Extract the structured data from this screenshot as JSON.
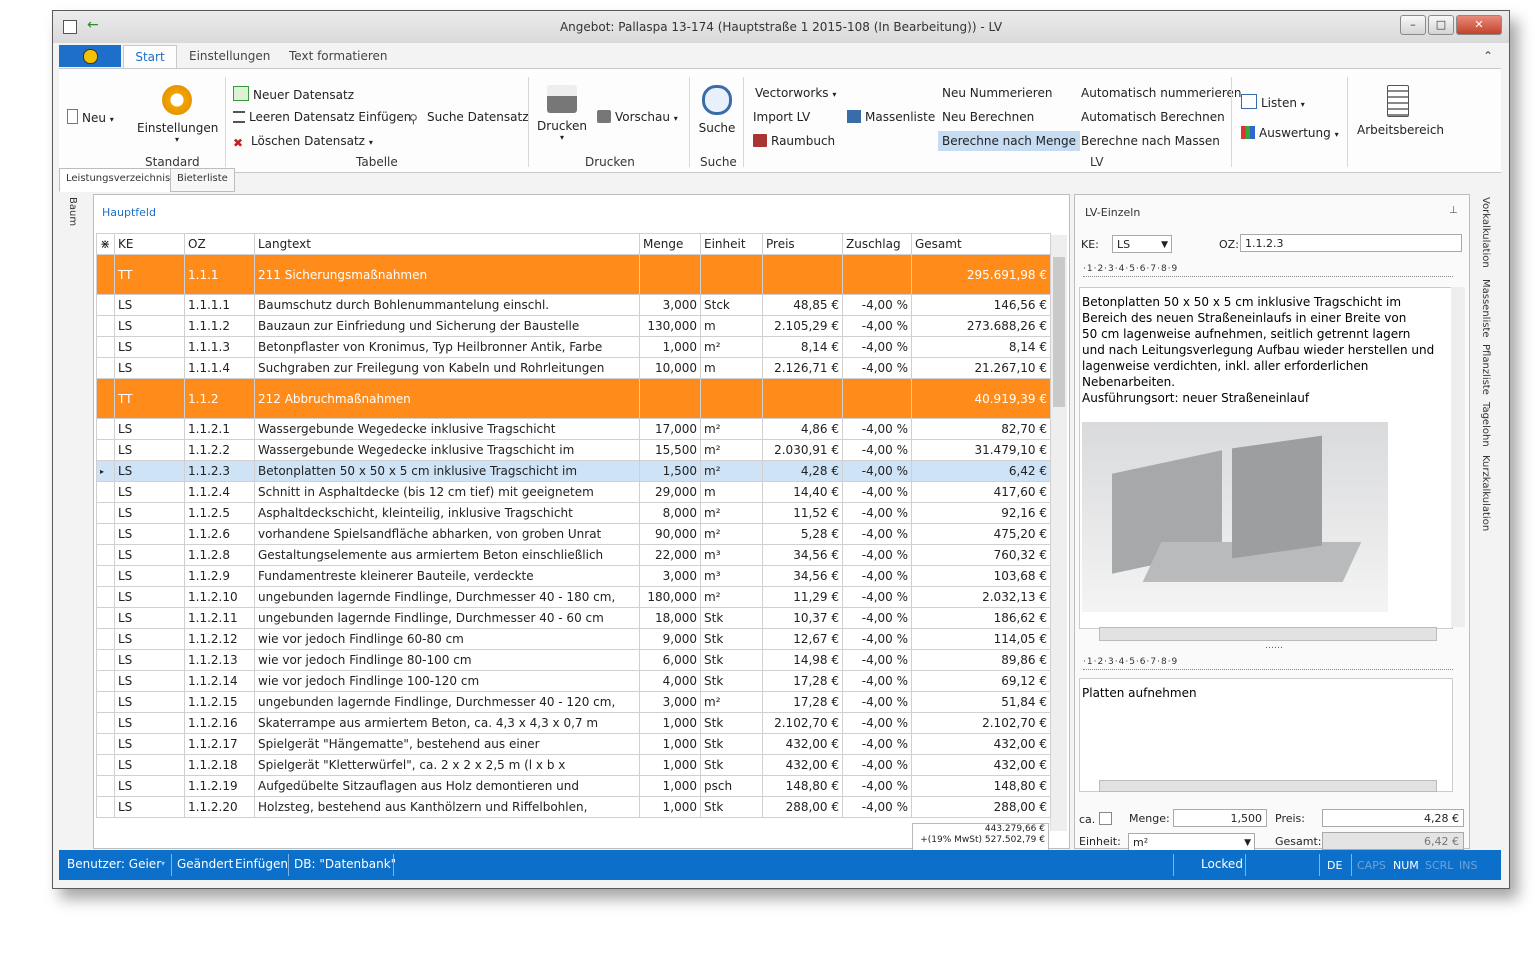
{
  "window": {
    "title": "Angebot: Pallaspa 13-174 (Hauptstraße 1 2015-108 (In Bearbeitung)) - LV"
  },
  "ribbon_tabs": [
    "Start",
    "Einstellungen",
    "Text formatieren"
  ],
  "ribbon": {
    "neu": "Neu",
    "einstellungen": "Einstellungen",
    "standard": "Standard",
    "neuer_datensatz": "Neuer Datensatz",
    "leeren_einfuegen": "Leeren Datensatz Einfügen",
    "loeschen": "Löschen Datensatz",
    "suche_datensatz": "Suche Datensatz",
    "tabelle": "Tabelle",
    "drucken": "Drucken",
    "vorschau": "Vorschau",
    "drucken_group": "Drucken",
    "suche": "Suche",
    "suche_group": "Suche",
    "vectorworks": "Vectorworks",
    "import_lv": "Import LV",
    "raumbuch": "Raumbuch",
    "massenliste": "Massenliste",
    "neu_nummerieren": "Neu Nummerieren",
    "neu_berechnen": "Neu Berechnen",
    "berechne_menge": "Berechne nach Menge",
    "auto_nummerieren": "Automatisch nummerieren",
    "auto_berechnen": "Automatisch Berechnen",
    "berechne_massen": "Berechne nach Massen",
    "lv_group": "LV",
    "listen": "Listen",
    "auswertung": "Auswertung",
    "arbeitsbereich": "Arbeitsbereich"
  },
  "subtabs": [
    "Leistungsverzeichnis",
    "Bieterliste"
  ],
  "left_vtab": "Baum",
  "grid": {
    "panel_title": "Hauptfeld",
    "headers": [
      "KE",
      "OZ",
      "Langtext",
      "Menge",
      "Einheit",
      "Preis",
      "Zuschlag",
      "Gesamt"
    ],
    "rows": [
      {
        "ke": "TT",
        "oz": "1.1.1",
        "text": "211 Sicherungsmaßnahmen",
        "menge": "",
        "einheit": "",
        "preis": "",
        "zuschlag": "",
        "gesamt": "295.691,98 €",
        "group": true
      },
      {
        "ke": "LS",
        "oz": "1.1.1.1",
        "text": "Baumschutz durch Bohlenummantelung einschl.",
        "menge": "3,000",
        "einheit": "Stck",
        "preis": "48,85 €",
        "zuschlag": "-4,00 %",
        "gesamt": "146,56 €"
      },
      {
        "ke": "LS",
        "oz": "1.1.1.2",
        "text": "Bauzaun zur Einfriedung und Sicherung der Baustelle",
        "menge": "130,000",
        "einheit": "m",
        "preis": "2.105,29 €",
        "zuschlag": "-4,00 %",
        "gesamt": "273.688,26 €"
      },
      {
        "ke": "LS",
        "oz": "1.1.1.3",
        "text": "Betonpflaster von Kronimus, Typ Heilbronner Antik, Farbe",
        "menge": "1,000",
        "einheit": "m²",
        "preis": "8,14 €",
        "zuschlag": "-4,00 %",
        "gesamt": "8,14 €"
      },
      {
        "ke": "LS",
        "oz": "1.1.1.4",
        "text": "Suchgraben zur Freilegung von Kabeln und Rohrleitungen",
        "menge": "10,000",
        "einheit": "m",
        "preis": "2.126,71 €",
        "zuschlag": "-4,00 %",
        "gesamt": "21.267,10 €"
      },
      {
        "ke": "TT",
        "oz": "1.1.2",
        "text": "212 Abbruchmaßnahmen",
        "menge": "",
        "einheit": "",
        "preis": "",
        "zuschlag": "",
        "gesamt": "40.919,39 €",
        "group": true
      },
      {
        "ke": "LS",
        "oz": "1.1.2.1",
        "text": "Wassergebunde Wegedecke inklusive Tragschicht",
        "menge": "17,000",
        "einheit": "m²",
        "preis": "4,86 €",
        "zuschlag": "-4,00 %",
        "gesamt": "82,70 €"
      },
      {
        "ke": "LS",
        "oz": "1.1.2.2",
        "text": "Wassergebunde Wegedecke inklusive Tragschicht im",
        "menge": "15,500",
        "einheit": "m²",
        "preis": "2.030,91 €",
        "zuschlag": "-4,00 %",
        "gesamt": "31.479,10 €"
      },
      {
        "ke": "LS",
        "oz": "1.1.2.3",
        "text": "Betonplatten 50 x 50 x 5 cm inklusive Tragschicht im",
        "menge": "1,500",
        "einheit": "m²",
        "preis": "4,28 €",
        "zuschlag": "-4,00 %",
        "gesamt": "6,42 €",
        "selected": true
      },
      {
        "ke": "LS",
        "oz": "1.1.2.4",
        "text": "Schnitt in Asphaltdecke (bis 12 cm tief) mit geeignetem",
        "menge": "29,000",
        "einheit": "m",
        "preis": "14,40 €",
        "zuschlag": "-4,00 %",
        "gesamt": "417,60 €"
      },
      {
        "ke": "LS",
        "oz": "1.1.2.5",
        "text": "Asphaltdeckschicht, kleinteilig, inklusive Tragschicht",
        "menge": "8,000",
        "einheit": "m²",
        "preis": "11,52 €",
        "zuschlag": "-4,00 %",
        "gesamt": "92,16 €"
      },
      {
        "ke": "LS",
        "oz": "1.1.2.6",
        "text": "vorhandene Spielsandfläche abharken, von groben Unrat",
        "menge": "90,000",
        "einheit": "m²",
        "preis": "5,28 €",
        "zuschlag": "-4,00 %",
        "gesamt": "475,20 €"
      },
      {
        "ke": "LS",
        "oz": "1.1.2.8",
        "text": "Gestaltungselemente aus armiertem Beton einschließlich",
        "menge": "22,000",
        "einheit": "m³",
        "preis": "34,56 €",
        "zuschlag": "-4,00 %",
        "gesamt": "760,32 €"
      },
      {
        "ke": "LS",
        "oz": "1.1.2.9",
        "text": "Fundamentreste kleinerer Bauteile, verdeckte",
        "menge": "3,000",
        "einheit": "m³",
        "preis": "34,56 €",
        "zuschlag": "-4,00 %",
        "gesamt": "103,68 €"
      },
      {
        "ke": "LS",
        "oz": "1.1.2.10",
        "text": "ungebunden lagernde Findlinge, Durchmesser 40 - 180 cm,",
        "menge": "180,000",
        "einheit": "m²",
        "preis": "11,29 €",
        "zuschlag": "-4,00 %",
        "gesamt": "2.032,13 €"
      },
      {
        "ke": "LS",
        "oz": "1.1.2.11",
        "text": "ungebunden lagernde Findlinge, Durchmesser 40 - 60 cm",
        "menge": "18,000",
        "einheit": "Stk",
        "preis": "10,37 €",
        "zuschlag": "-4,00 %",
        "gesamt": "186,62 €"
      },
      {
        "ke": "LS",
        "oz": "1.1.2.12",
        "text": "wie vor jedoch Findlinge 60-80 cm",
        "menge": "9,000",
        "einheit": "Stk",
        "preis": "12,67 €",
        "zuschlag": "-4,00 %",
        "gesamt": "114,05 €"
      },
      {
        "ke": "LS",
        "oz": "1.1.2.13",
        "text": "wie vor jedoch Findlinge 80-100 cm",
        "menge": "6,000",
        "einheit": "Stk",
        "preis": "14,98 €",
        "zuschlag": "-4,00 %",
        "gesamt": "89,86 €"
      },
      {
        "ke": "LS",
        "oz": "1.1.2.14",
        "text": "wie vor jedoch Findlinge 100-120 cm",
        "menge": "4,000",
        "einheit": "Stk",
        "preis": "17,28 €",
        "zuschlag": "-4,00 %",
        "gesamt": "69,12 €"
      },
      {
        "ke": "LS",
        "oz": "1.1.2.15",
        "text": "ungebunden lagernde Findlinge, Durchmesser 40 - 120 cm,",
        "menge": "3,000",
        "einheit": "m²",
        "preis": "17,28 €",
        "zuschlag": "-4,00 %",
        "gesamt": "51,84 €"
      },
      {
        "ke": "LS",
        "oz": "1.1.2.16",
        "text": "Skaterrampe aus armiertem Beton, ca. 4,3 x 4,3 x  0,7 m",
        "menge": "1,000",
        "einheit": "Stk",
        "preis": "2.102,70 €",
        "zuschlag": "-4,00 %",
        "gesamt": "2.102,70 €"
      },
      {
        "ke": "LS",
        "oz": "1.1.2.17",
        "text": "Spielgerät \"Hängematte\", bestehend aus einer",
        "menge": "1,000",
        "einheit": "Stk",
        "preis": "432,00 €",
        "zuschlag": "-4,00 %",
        "gesamt": "432,00 €"
      },
      {
        "ke": "LS",
        "oz": "1.1.2.18",
        "text": "Spielgerät \"Kletterwürfel\", ca. 2 x 2 x 2,5 m (l x b x",
        "menge": "1,000",
        "einheit": "Stk",
        "preis": "432,00 €",
        "zuschlag": "-4,00 %",
        "gesamt": "432,00 €"
      },
      {
        "ke": "LS",
        "oz": "1.1.2.19",
        "text": "Aufgedübelte Sitzauflagen aus Holz demontieren und",
        "menge": "1,000",
        "einheit": "psch",
        "preis": "148,80 €",
        "zuschlag": "-4,00 %",
        "gesamt": "148,80 €"
      },
      {
        "ke": "LS",
        "oz": "1.1.2.20",
        "text": "Holzsteg, bestehend aus Kanthölzern und Riffelbohlen,",
        "menge": "1,000",
        "einheit": "Stk",
        "preis": "288,00 €",
        "zuschlag": "-4,00 %",
        "gesamt": "288,00 €"
      }
    ],
    "total_net": "443.279,66 €",
    "total_gross": "+(19% MwSt) 527.502,79 €"
  },
  "detail": {
    "title": "LV-Einzeln",
    "ke_label": "KE:",
    "ke_value": "LS",
    "oz_label": "OZ:",
    "oz_value": "1.1.2.3",
    "ruler": "·1·2·3·4·5·6·7·8·9",
    "langtext": [
      "Betonplatten 50 x 50 x 5 cm inklusive Tragschicht im",
      "Bereich des neuen Straßeneinlaufs in einer Breite von",
      "50 cm lagenweise aufnehmen, seitlich getrennt lagern",
      "und nach Leitungsverlegung Aufbau wieder herstellen und",
      "lagenweise verdichten, inkl. aller erforderlichen",
      "Nebenarbeiten.",
      "Ausführungsort: neuer Straßeneinlauf"
    ],
    "kurztext": "Platten aufnehmen",
    "ca_label": "ca.",
    "menge_label": "Menge:",
    "menge_value": "1,500",
    "preis_label": "Preis:",
    "preis_value": "4,28 €",
    "einheit_label": "Einheit:",
    "einheit_value": "m²",
    "gesamt_label": "Gesamt:",
    "gesamt_value": "6,42 €"
  },
  "right_vtabs": [
    "Vorkalkulation",
    "Massenliste",
    "Pflanzliste",
    "Tagelohn",
    "Kurzkalkulation"
  ],
  "status": {
    "benutzer": "Benutzer: Geier",
    "geaendert": "Geändert",
    "einfuegen": "Einfügen",
    "db": "DB: \"Datenbank\"",
    "locked": "Locked",
    "lang": "DE",
    "caps": "CAPS",
    "num": "NUM",
    "scrl": "SCRL",
    "ins": "INS"
  },
  "colors": {
    "group_row": "#ff8c1a",
    "selected_row": "#cfe3f7",
    "statusbar": "#0c6fc9",
    "accent": "#1e6fc9"
  }
}
